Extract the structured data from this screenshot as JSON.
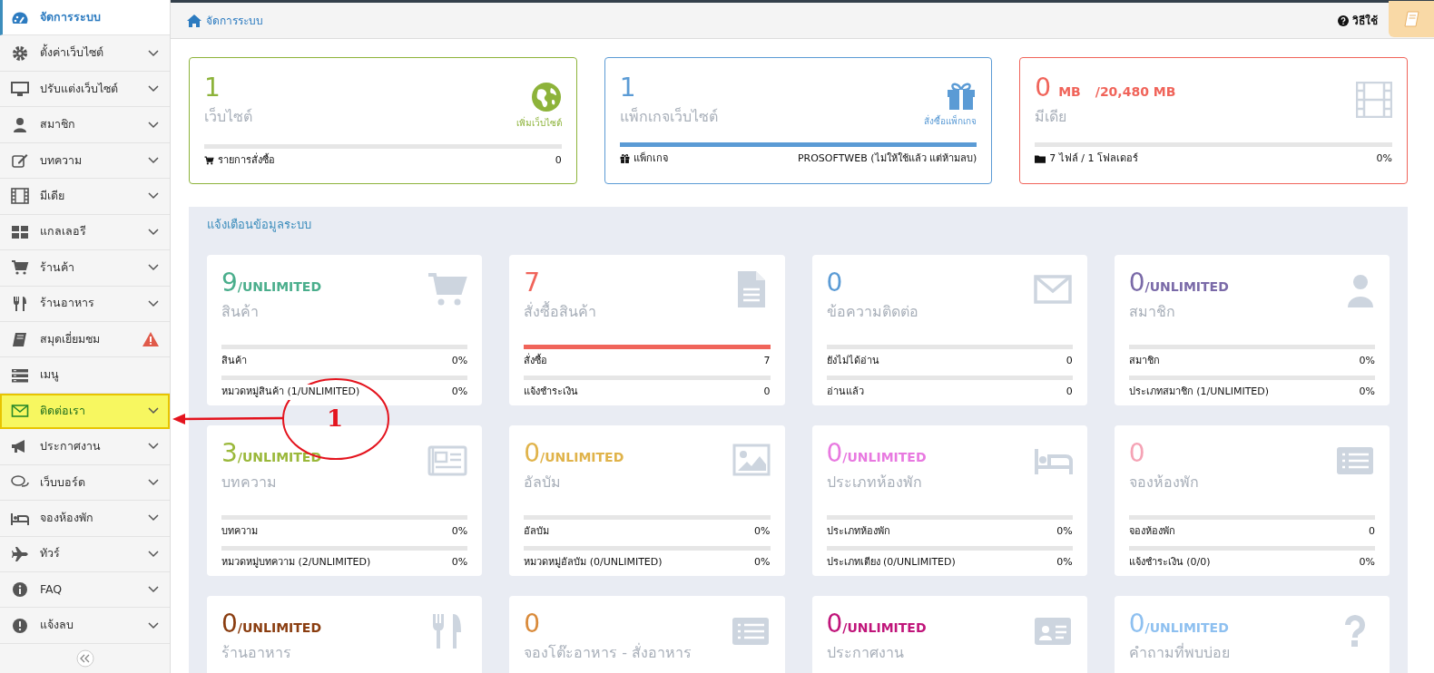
{
  "sidebar": {
    "items": [
      {
        "label": "จัดการระบบ",
        "selected": true,
        "highlighted": false,
        "expandable": false,
        "alert": false
      },
      {
        "label": "ตั้งค่าเว็บไซต์",
        "selected": false,
        "highlighted": false,
        "expandable": true,
        "alert": false
      },
      {
        "label": "ปรับแต่งเว็บไซต์",
        "selected": false,
        "highlighted": false,
        "expandable": true,
        "alert": false
      },
      {
        "label": "สมาชิก",
        "selected": false,
        "highlighted": false,
        "expandable": true,
        "alert": false
      },
      {
        "label": "บทความ",
        "selected": false,
        "highlighted": false,
        "expandable": true,
        "alert": false
      },
      {
        "label": "มีเดีย",
        "selected": false,
        "highlighted": false,
        "expandable": true,
        "alert": false
      },
      {
        "label": "แกลเลอรี",
        "selected": false,
        "highlighted": false,
        "expandable": true,
        "alert": false
      },
      {
        "label": "ร้านค้า",
        "selected": false,
        "highlighted": false,
        "expandable": true,
        "alert": false
      },
      {
        "label": "ร้านอาหาร",
        "selected": false,
        "highlighted": false,
        "expandable": true,
        "alert": false
      },
      {
        "label": "สมุดเยี่ยมชม",
        "selected": false,
        "highlighted": false,
        "expandable": false,
        "alert": true
      },
      {
        "label": "เมนู",
        "selected": false,
        "highlighted": false,
        "expandable": false,
        "alert": false
      },
      {
        "label": "ติดต่อเรา",
        "selected": false,
        "highlighted": true,
        "expandable": true,
        "alert": false
      },
      {
        "label": "ประกาศงาน",
        "selected": false,
        "highlighted": false,
        "expandable": true,
        "alert": false
      },
      {
        "label": "เว็บบอร์ด",
        "selected": false,
        "highlighted": false,
        "expandable": true,
        "alert": false
      },
      {
        "label": "จองห้องพัก",
        "selected": false,
        "highlighted": false,
        "expandable": true,
        "alert": false
      },
      {
        "label": "ทัวร์",
        "selected": false,
        "highlighted": false,
        "expandable": true,
        "alert": false
      },
      {
        "label": "FAQ",
        "selected": false,
        "highlighted": false,
        "expandable": true,
        "alert": false
      },
      {
        "label": "แจ้งลบ",
        "selected": false,
        "highlighted": false,
        "expandable": true,
        "alert": false
      }
    ]
  },
  "header": {
    "breadcrumb": "จัดการระบบ",
    "help": "วิธีใช้"
  },
  "summary_cards": [
    {
      "kind": "website",
      "color": "#8db33a",
      "count": "1",
      "title": "เว็บไซต์",
      "action": "เพิ่มเว็บไซต์",
      "footer": {
        "label": "รายการสั่งซื้อ",
        "value": "0",
        "level": 0
      }
    },
    {
      "kind": "package",
      "color": "#5b9bd5",
      "count": "1",
      "title": "แพ็กเกจเว็บไซต์",
      "action": "สั่งซื้อแพ็กเกจ",
      "footer": {
        "label": "แพ็กเกจ",
        "value": "PROSOFTWEB (ไม่ให้ใช้แล้ว แต่ห้ามลบ)",
        "level": 1
      }
    },
    {
      "kind": "media",
      "color": "#f0645a",
      "count": "0",
      "unit": "MB",
      "quota": "/20,480 MB",
      "title": "มีเดีย",
      "footer": {
        "label": "7 ไฟล์ / 1 โฟลเดอร์",
        "value": "0%",
        "level": 0
      }
    }
  ],
  "notices": {
    "title": "แจ้งเตือนข้อมูลระบบ",
    "cards": [
      {
        "count": "9",
        "limit": "/UNLIMITED",
        "title": "สินค้า",
        "color": "#4aae8c",
        "rows": [
          {
            "label": "สินค้า",
            "value": "0%",
            "level": 0
          },
          {
            "label": "หมวดหมู่สินค้า (1/UNLIMITED)",
            "value": "0%",
            "level": 0
          }
        ]
      },
      {
        "count": "7",
        "title": "สั่งซื้อสินค้า",
        "color": "#f0645a",
        "rows": [
          {
            "label": "สั่งซื้อ",
            "value": "7",
            "level": 1
          },
          {
            "label": "แจ้งชำระเงิน",
            "value": "0",
            "level": 0
          }
        ]
      },
      {
        "count": "0",
        "title": "ข้อความติดต่อ",
        "color": "#5b9bd5",
        "rows": [
          {
            "label": "ยังไม่ได้อ่าน",
            "value": "0",
            "level": 0
          },
          {
            "label": "อ่านแล้ว",
            "value": "0",
            "level": 0
          }
        ]
      },
      {
        "count": "0",
        "limit": "/UNLIMITED",
        "title": "สมาชิก",
        "color": "#7a6aa8",
        "rows": [
          {
            "label": "สมาชิก",
            "value": "0%",
            "level": 0
          },
          {
            "label": "ประเภทสมาชิก (1/UNLIMITED)",
            "value": "0%",
            "level": 0
          }
        ]
      },
      {
        "count": "3",
        "limit": "/UNLIMITED",
        "title": "บทความ",
        "color": "#9ab83a",
        "rows": [
          {
            "label": "บทความ",
            "value": "0%",
            "level": 0
          },
          {
            "label": "หมวดหมู่บทความ (2/UNLIMITED)",
            "value": "0%",
            "level": 0
          }
        ]
      },
      {
        "count": "0",
        "limit": "/UNLIMITED",
        "title": "อัลบัม",
        "color": "#e0b34a",
        "rows": [
          {
            "label": "อัลบัม",
            "value": "0%",
            "level": 0
          },
          {
            "label": "หมวดหมู่อัลบัม (0/UNLIMITED)",
            "value": "0%",
            "level": 0
          }
        ]
      },
      {
        "count": "0",
        "limit": "/UNLIMITED",
        "title": "ประเภทห้องพัก",
        "color": "#e879e0",
        "rows": [
          {
            "label": "ประเภทห้องพัก",
            "value": "0%",
            "level": 0
          },
          {
            "label": "ประเภทเตียง (0/UNLIMITED)",
            "value": "0%",
            "level": 0
          }
        ]
      },
      {
        "count": "0",
        "title": "จองห้องพัก",
        "color": "#f5a3b5",
        "rows": [
          {
            "label": "จองห้องพัก",
            "value": "0",
            "level": 0
          },
          {
            "label": "แจ้งชำระเงิน (0/0)",
            "value": "0%",
            "level": 0
          }
        ]
      },
      {
        "count": "0",
        "limit": "/UNLIMITED",
        "title": "ร้านอาหาร",
        "color": "#8a3d10"
      },
      {
        "count": "0",
        "title": "จองโต๊ะอาหาร - สั่งอาหาร",
        "color": "#d98a3a"
      },
      {
        "count": "0",
        "limit": "/UNLIMITED",
        "title": "ประกาศงาน",
        "color": "#c0157a"
      },
      {
        "count": "0",
        "limit": "/UNLIMITED",
        "title": "คำถามที่พบบ่อย",
        "color": "#8ec0f0"
      }
    ]
  },
  "annotation": {
    "label": "1"
  }
}
